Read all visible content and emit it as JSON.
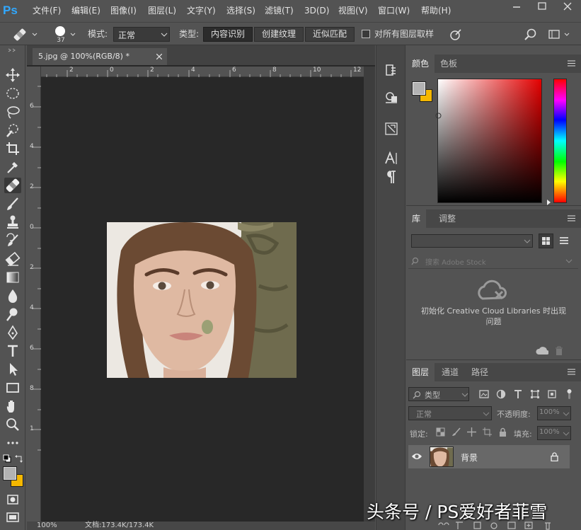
{
  "app": {
    "logo": "Ps",
    "accent": "#31a8ff"
  },
  "menu": [
    "文件(F)",
    "编辑(E)",
    "图像(I)",
    "图层(L)",
    "文字(Y)",
    "选择(S)",
    "滤镜(T)",
    "3D(D)",
    "视图(V)",
    "窗口(W)",
    "帮助(H)"
  ],
  "options": {
    "brush_size": "37",
    "mode_label": "模式:",
    "mode_value": "正常",
    "type_label": "类型:",
    "types": [
      "内容识别",
      "创建纹理",
      "近似匹配"
    ],
    "active_type": 0,
    "sample_all_label": "对所有图层取样"
  },
  "document": {
    "tab_title": "5.jpg @ 100%(RGB/8) *",
    "h_ruler_ticks": [
      "2",
      "0",
      "2",
      "4",
      "6",
      "8",
      "10",
      "12"
    ],
    "v_ruler_ticks": [
      "6",
      "4",
      "2",
      "0",
      "2",
      "4",
      "6",
      "8",
      "1"
    ],
    "zoom": "100%",
    "doc_size": "文档:173.4K/173.4K"
  },
  "color_panel": {
    "tabs": [
      "颜色",
      "色板"
    ],
    "foreground": "#b3b3b3",
    "background": "#f5b800"
  },
  "library_panel": {
    "tabs": [
      "库",
      "调整"
    ],
    "search_placeholder": "搜索 Adobe Stock",
    "message": "初始化 Creative Cloud Libraries 时出现问题"
  },
  "layers_panel": {
    "tabs": [
      "图层",
      "通道",
      "路径"
    ],
    "kind_label": "类型",
    "blend_mode": "正常",
    "opacity_label": "不透明度:",
    "opacity_value": "100%",
    "lock_label": "锁定:",
    "fill_label": "填充:",
    "fill_value": "100%",
    "layers": [
      {
        "name": "背景",
        "visible": true,
        "locked": true
      }
    ]
  },
  "watermark": "头条号 / PS爱好者菲雪"
}
